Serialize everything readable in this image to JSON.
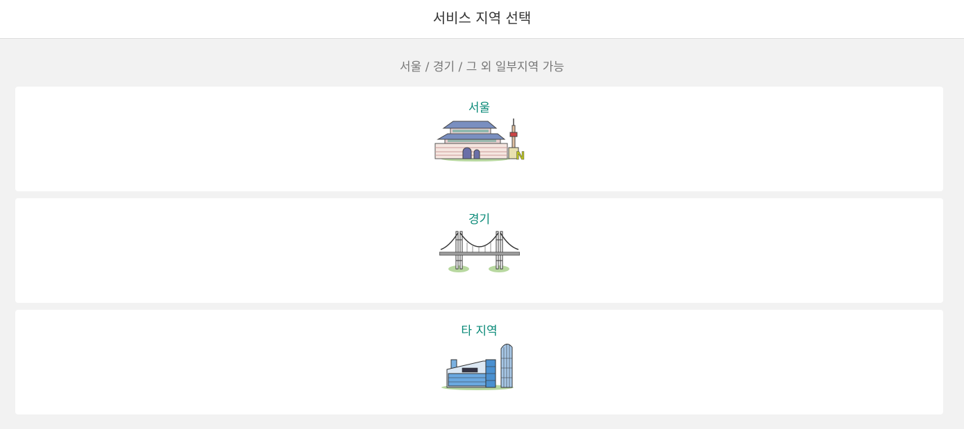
{
  "header": {
    "title": "서비스 지역 선택"
  },
  "subtitle": "서울 / 경기 / 그 외 일부지역 가능",
  "regions": [
    {
      "label": "서울",
      "icon": "seoul-landmark-icon"
    },
    {
      "label": "경기",
      "icon": "bridge-icon"
    },
    {
      "label": "타 지역",
      "icon": "city-buildings-icon"
    }
  ],
  "colors": {
    "accent": "#0a8a78",
    "background": "#f2f2f2",
    "card": "#ffffff",
    "header_text": "#333333",
    "subtitle_text": "#777777"
  }
}
